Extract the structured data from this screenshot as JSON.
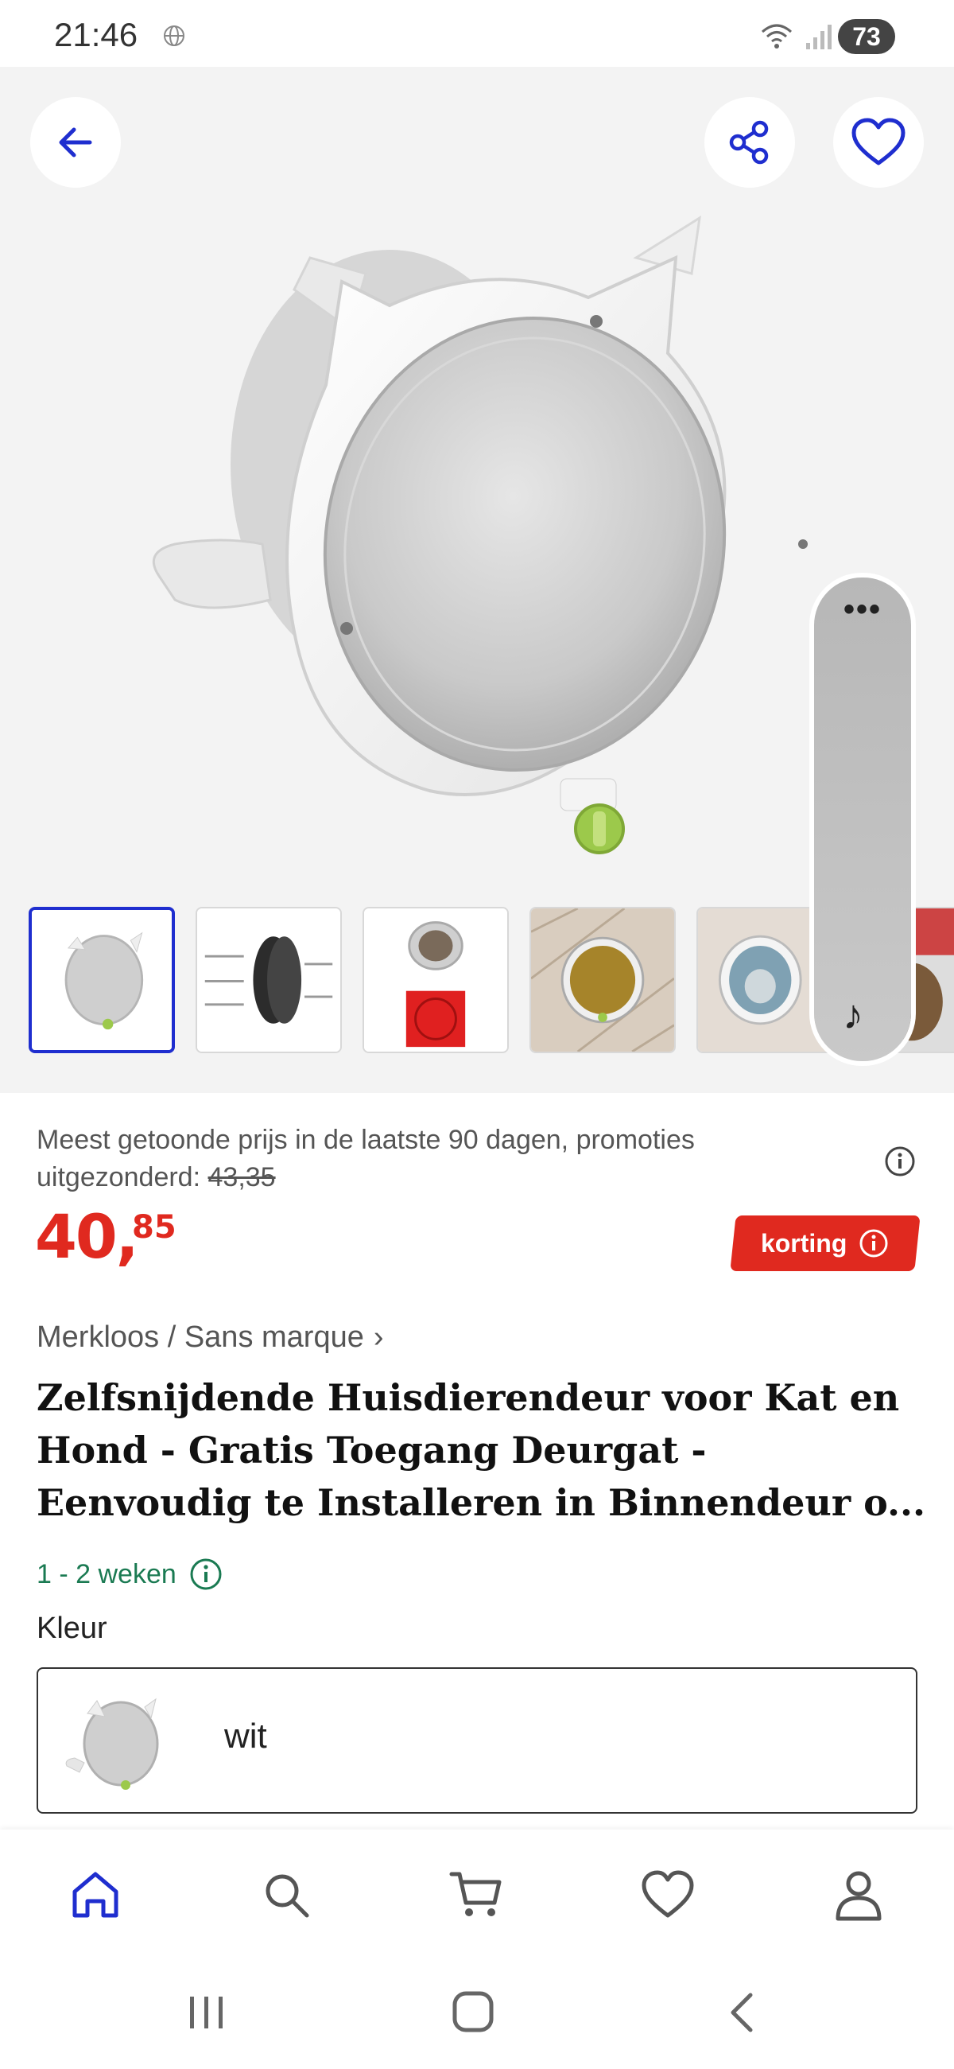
{
  "status_bar": {
    "time": "21:46",
    "battery": "73"
  },
  "gallery": {
    "thumbnails": [
      "product-front",
      "product-dimensions",
      "product-installed-red",
      "product-wood-door",
      "product-cat-window",
      "product-cat-photo"
    ],
    "selected_index": 0
  },
  "price": {
    "note_prefix": "Meest getoonde prijs in de laatste 90 dagen, promoties uitgezonderd: ",
    "old_price": "43,35",
    "main": "40,",
    "cents": "85",
    "badge": "korting"
  },
  "product": {
    "brand": "Merkloos / Sans marque",
    "title": "Zelfsnijdende Huisdierendeur voor Kat en Hond - Gratis Toegang Deurgat - Eenvoudig te Installeren in Binnendeur o...",
    "delivery": "1 - 2 weken",
    "color_label": "Kleur",
    "color_value": "wit"
  },
  "colors": {
    "accent": "#1f2ecf",
    "price": "#e0291f",
    "delivery": "#1a7a52"
  },
  "icons": {
    "back": "arrow-left-icon",
    "share": "share-icon",
    "favorite": "heart-icon",
    "home": "home-icon",
    "search": "search-icon",
    "cart": "cart-icon",
    "wishlist": "heart-icon",
    "account": "user-icon"
  }
}
